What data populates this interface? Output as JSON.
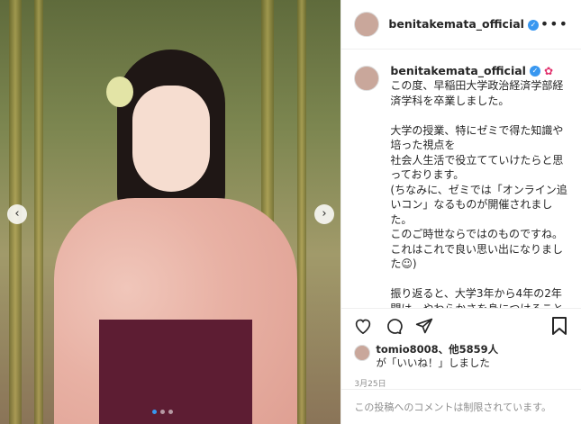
{
  "post": {
    "username": "benitakemata_official",
    "verified_icon": "verified-badge-icon",
    "more_icon": "more-options-icon"
  },
  "caption": {
    "username": "benitakemata_official",
    "emoji": "flower-emoji",
    "text": "この度、早稲田大学政治経済学部経済学科を卒業しました。\n\n大学の授業、特にゼミで得た知識や培った視点を\n社会人生活で役立てていけたらと思っております。\n(ちなみに、ゼミでは「オンライン追いコン」なるものが開催されました。\nこのご時世ならではのものですね。\nこれはこれで良い思い出になりました☺︎)\n\n振り返ると、大学3年から4年の2年間は、やわらかさを身につけることを意識していました。\nストレッチで体をやわらかくすることも頑張りましたが(頑張ったけどまだか"
  },
  "actions": {
    "like_icon": "heart-icon",
    "comment_icon": "comment-icon",
    "share_icon": "share-icon",
    "save_icon": "bookmark-icon"
  },
  "likes": {
    "line1": "tomio8008、他5859人",
    "line2": "が「いいね！」しました"
  },
  "date": "3月25日",
  "comment_bar": {
    "text": "この投稿へのコメントは制限されています。"
  },
  "carousel": {
    "prev_label": "‹",
    "next_label": "›"
  }
}
